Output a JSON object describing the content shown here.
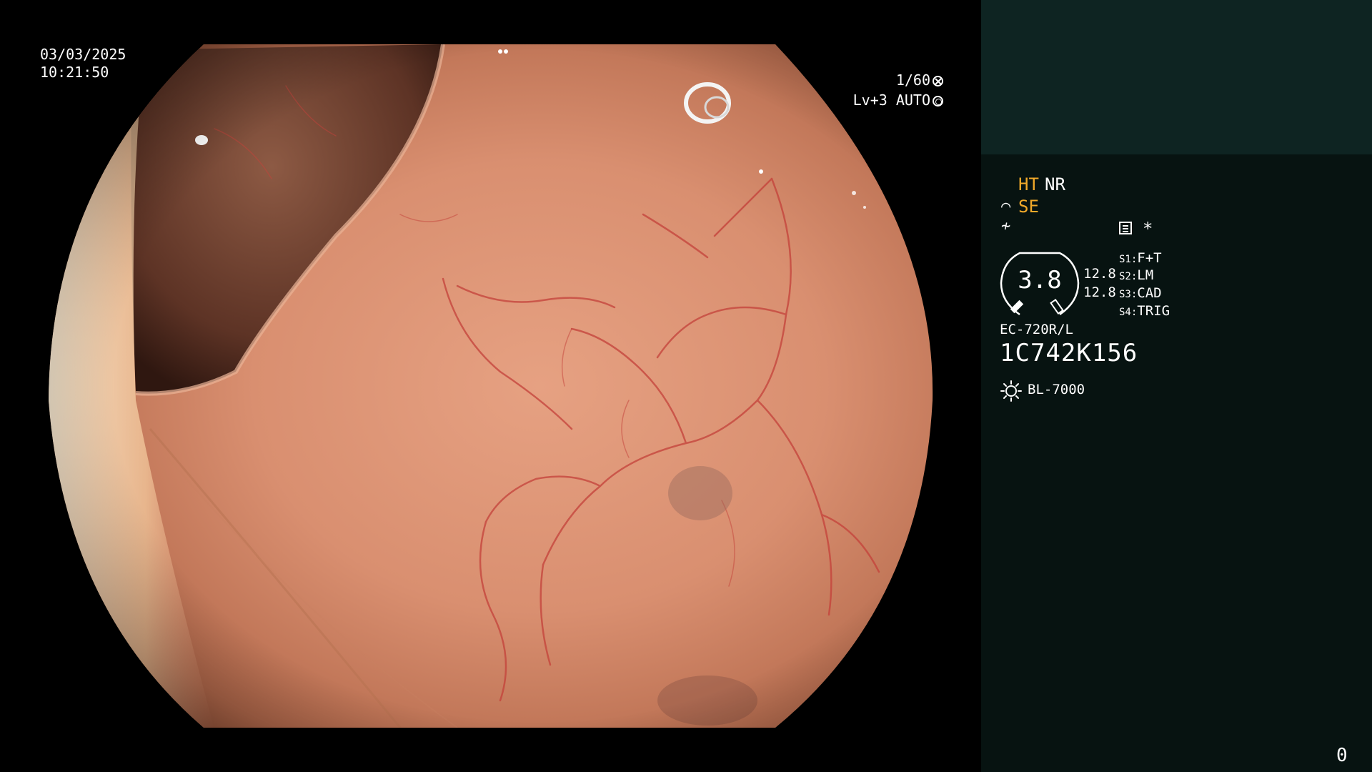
{
  "endoscope_view": {
    "date": "03/03/2025",
    "time": "10:21:50",
    "shutter": "1/60",
    "shutter_icon": "aperture-icon",
    "level": "Lv+3 AUTO",
    "level_icon": "iris-icon"
  },
  "info_panel": {
    "ht_label": "HT",
    "nr_label": "NR",
    "se_label": "SE",
    "se_icon": "enhance-curve-icon",
    "hf_icon": "filter-icon",
    "memo_icon": "memo-icon",
    "asterisk": "*",
    "gauge_value": "3.8",
    "gauge_icon": "zoom-gauge-icon",
    "gauge_values": [
      "12.8",
      "12.8"
    ],
    "switches": [
      {
        "key": "S1:",
        "value": "F+T"
      },
      {
        "key": "S2:",
        "value": "LM"
      },
      {
        "key": "S3:",
        "value": "CAD"
      },
      {
        "key": "S4:",
        "value": "TRIG"
      }
    ],
    "scope_model": "EC-720R/L",
    "scope_serial": "1C742K156",
    "light_icon": "light-source-icon",
    "light_source": "BL-7000",
    "counter": "0"
  },
  "colors": {
    "panel_bg": "#071311",
    "panel_top_bg": "#0e2422",
    "accent_orange": "#f1a92a",
    "text": "#ffffff"
  }
}
